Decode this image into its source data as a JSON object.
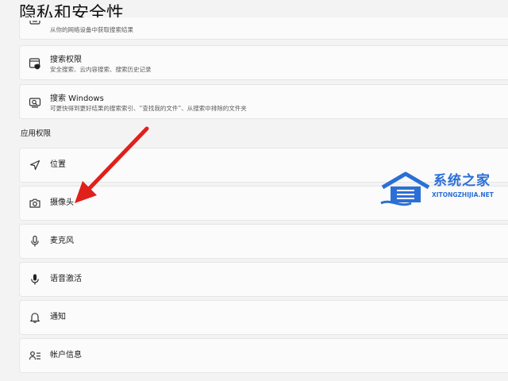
{
  "page": {
    "title": "隐私和安全性"
  },
  "top_partial": {
    "desc": "从你的网络设备中获取搜索结果"
  },
  "search_permissions": {
    "title": "搜索权限",
    "desc": "安全搜索、云内容搜索、搜索历史记录",
    "icon": "search-permission-icon"
  },
  "search_windows": {
    "title": "搜索 Windows",
    "desc": "可更快得到更好结果的搜索索引、“查找我的文件”、从搜索中排除的文件夹",
    "icon": "search-windows-icon"
  },
  "app_permissions": {
    "header": "应用权限",
    "items": [
      {
        "label": "位置",
        "icon": "location-icon"
      },
      {
        "label": "摄像头",
        "icon": "camera-icon"
      },
      {
        "label": "麦克风",
        "icon": "microphone-icon"
      },
      {
        "label": "语音激活",
        "icon": "voice-activation-icon"
      },
      {
        "label": "通知",
        "icon": "notification-bell-icon"
      },
      {
        "label": "帐户信息",
        "icon": "account-info-icon"
      }
    ]
  },
  "annotation": {
    "arrow_color": "#e0201b"
  },
  "watermark": {
    "name": "系统之家",
    "url": "XITONGZHIJIA.NET",
    "color": "#2b6fd6"
  }
}
